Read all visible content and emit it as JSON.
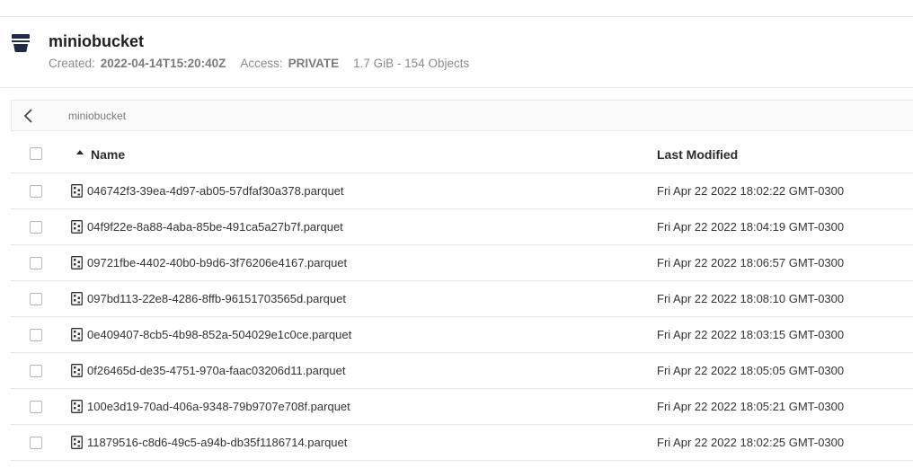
{
  "bucket": {
    "name": "miniobucket",
    "created_label": "Created:",
    "created_value": "2022-04-14T15:20:40Z",
    "access_label": "Access:",
    "access_value": "PRIVATE",
    "size_summary": "1.7 GiB - 154 Objects",
    "icon": "bucket-icon"
  },
  "breadcrumb": {
    "path": "miniobucket",
    "back_icon": "chevron-left-icon"
  },
  "table": {
    "columns": {
      "name": "Name",
      "last_modified": "Last Modified"
    },
    "sort_icon": "sort-ascending-icon",
    "rows": [
      {
        "name": "046742f3-39ea-4d97-ab05-57dfaf30a378.parquet",
        "modified": "Fri Apr 22 2022 18:02:22 GMT-0300"
      },
      {
        "name": "04f9f22e-8a88-4aba-85be-491ca5a27b7f.parquet",
        "modified": "Fri Apr 22 2022 18:04:19 GMT-0300"
      },
      {
        "name": "09721fbe-4402-40b0-b9d6-3f76206e4167.parquet",
        "modified": "Fri Apr 22 2022 18:06:57 GMT-0300"
      },
      {
        "name": "097bd113-22e8-4286-8ffb-96151703565d.parquet",
        "modified": "Fri Apr 22 2022 18:08:10 GMT-0300"
      },
      {
        "name": "0e409407-8cb5-4b98-852a-504029e1c0ce.parquet",
        "modified": "Fri Apr 22 2022 18:03:15 GMT-0300"
      },
      {
        "name": "0f26465d-de35-4751-970a-faac03206d11.parquet",
        "modified": "Fri Apr 22 2022 18:05:05 GMT-0300"
      },
      {
        "name": "100e3d19-70ad-406a-9348-79b9707e708f.parquet",
        "modified": "Fri Apr 22 2022 18:05:21 GMT-0300"
      },
      {
        "name": "11879516-c8d6-49c5-a94b-db35f1186714.parquet",
        "modified": "Fri Apr 22 2022 18:02:25 GMT-0300"
      }
    ]
  }
}
